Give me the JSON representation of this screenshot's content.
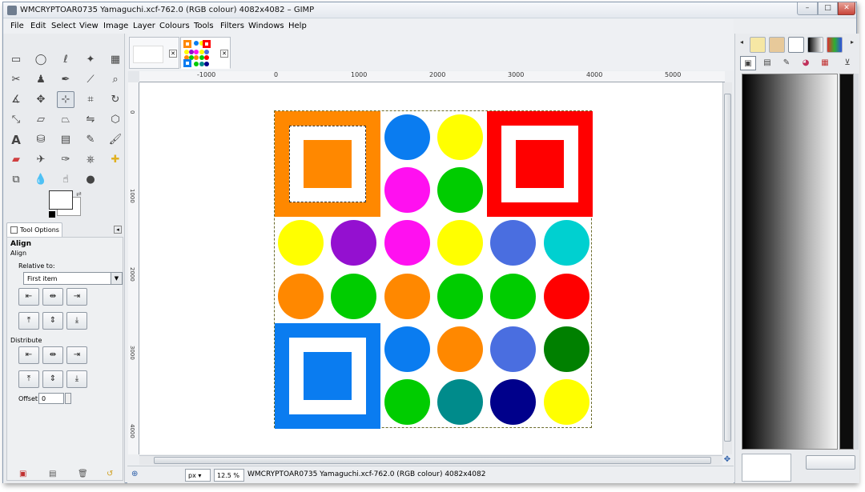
{
  "window": {
    "title": "WMCRYPTOAR0735 Yamaguchi.xcf-762.0 (RGB colour) 4082x4082 – GIMP",
    "min_label": "–",
    "max_label": "□",
    "close_label": "✕"
  },
  "menu": [
    "File",
    "Edit",
    "Select",
    "View",
    "Image",
    "Layer",
    "Colours",
    "Tools",
    "Filters",
    "Windows",
    "Help"
  ],
  "toolbox": {
    "tool_options_tab": "Tool Options",
    "options_title": "Align",
    "options_subtitle": "Align",
    "relative_to_label": "Relative to:",
    "relative_to_value": "First item",
    "distribute_label": "Distribute",
    "offset_label": "Offset:",
    "offset_value": "0"
  },
  "rulers": {
    "h_labels": [
      "-1000",
      "0",
      "1000",
      "2000",
      "3000",
      "4000",
      "5000"
    ],
    "v_labels": [
      "0",
      "1000",
      "2000",
      "3000",
      "4000"
    ]
  },
  "status": {
    "unit": "px",
    "zoom": "12.5 %",
    "message": "WMCRYPTOAR0735 Yamaguchi.xcf-762.0 (RGB colour) 4082x4082"
  },
  "image_content": {
    "squares": [
      {
        "name": "orange-square",
        "outer": "#ff8800",
        "inner": "#ff8800",
        "selected": true
      },
      {
        "name": "red-square",
        "outer": "#ff0000",
        "inner": "#ff0000",
        "selected": false
      },
      {
        "name": "blue-square",
        "outer": "#0a7cf0",
        "inner": "#0a7cf0",
        "selected": false
      }
    ],
    "circles": [
      {
        "color": "#0a7cf0"
      },
      {
        "color": "#ffff00"
      },
      {
        "color": "#ff10f0"
      },
      {
        "color": "#00cc00"
      },
      {
        "color": "#ffff00"
      },
      {
        "color": "#9410d0"
      },
      {
        "color": "#ff10f0"
      },
      {
        "color": "#ffff00"
      },
      {
        "color": "#4a6ee0"
      },
      {
        "color": "#00d0d0"
      },
      {
        "color": "#ff8800"
      },
      {
        "color": "#00cc00"
      },
      {
        "color": "#ff8800"
      },
      {
        "color": "#00cc00"
      },
      {
        "color": "#00cc00"
      },
      {
        "color": "#ff0000"
      },
      {
        "color": "#0a7cf0"
      },
      {
        "color": "#ff8800"
      },
      {
        "color": "#4a6ee0"
      },
      {
        "color": "#008000"
      },
      {
        "color": "#00cc00"
      },
      {
        "color": "#008b8b"
      },
      {
        "color": "#00008b"
      },
      {
        "color": "#ffff00"
      }
    ]
  }
}
